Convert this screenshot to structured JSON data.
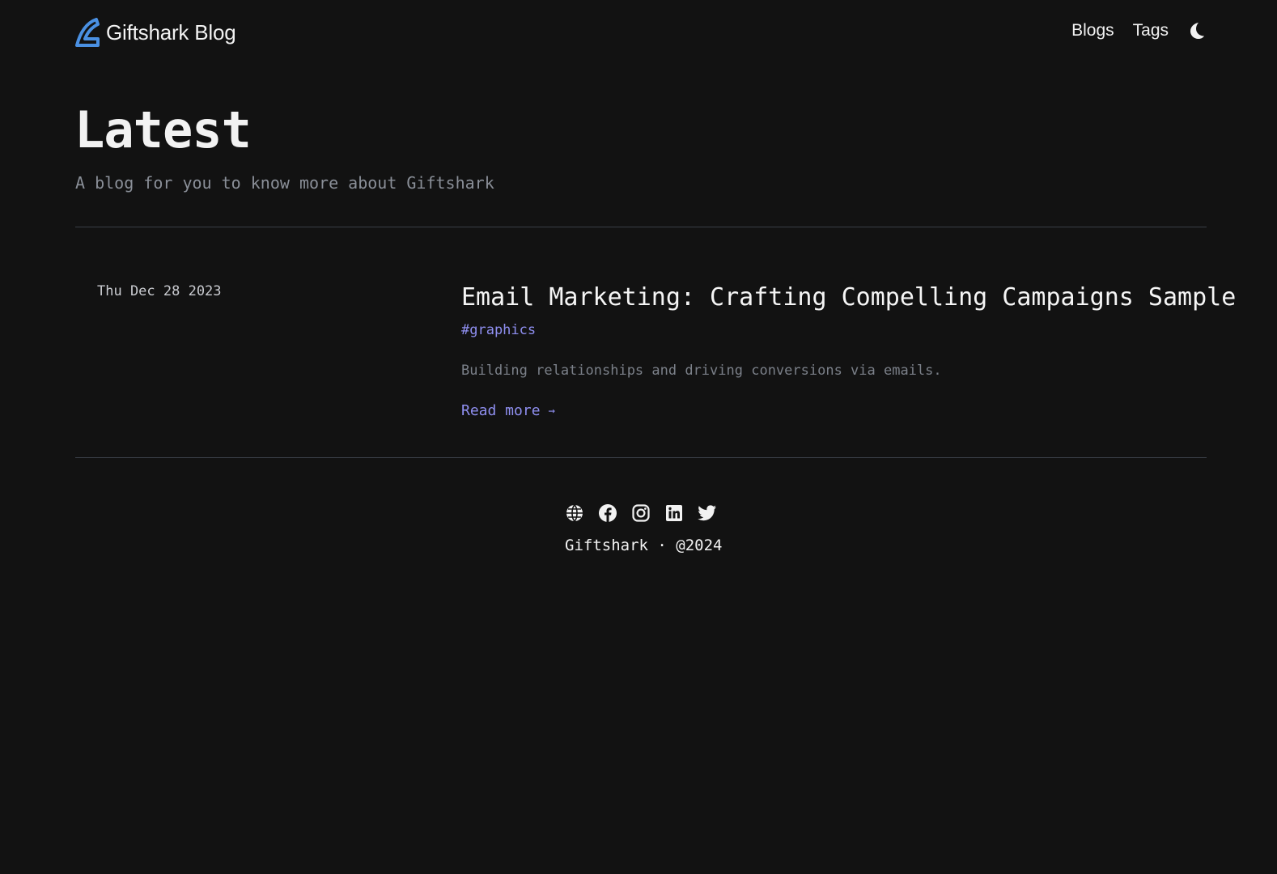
{
  "colors": {
    "background": "#121212",
    "text": "#f2f2f2",
    "muted": "#8a8f98",
    "accent": "#8f8ff0",
    "logo": "#3b82f6",
    "divider": "#3a3f47"
  },
  "header": {
    "logo_icon": "shark-fin-icon",
    "site_title": "Giftshark Blog",
    "nav": [
      {
        "label": "Blogs"
      },
      {
        "label": "Tags"
      }
    ],
    "theme_toggle_icon": "moon-icon"
  },
  "hero": {
    "title": "Latest",
    "subtitle": "A blog for you to know more about Giftshark"
  },
  "posts": [
    {
      "date": "Thu Dec 28 2023",
      "title": "Email Marketing: Crafting Compelling Campaigns Sample",
      "tag": "#graphics",
      "summary": "Building relationships and driving conversions via emails.",
      "read_more": "Read more",
      "read_more_arrow": "→"
    }
  ],
  "footer": {
    "social_icons": [
      "globe-icon",
      "facebook-icon",
      "instagram-icon",
      "linkedin-icon",
      "twitter-icon"
    ],
    "copyright": "Giftshark · @2024"
  }
}
